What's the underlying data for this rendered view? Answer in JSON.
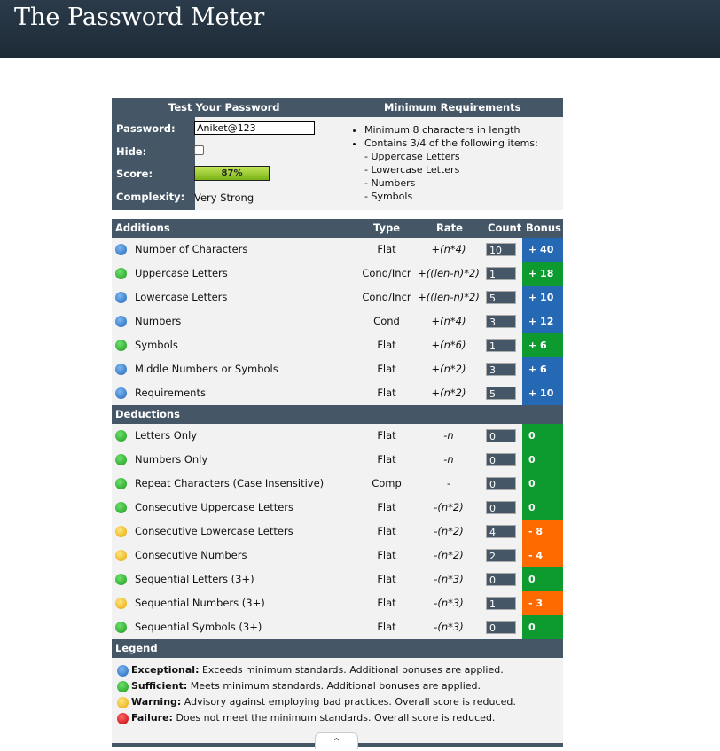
{
  "header": {
    "title": "The Password Meter"
  },
  "top": {
    "col1": "Test Your Password",
    "col2": "Minimum Requirements",
    "password_label": "Password:",
    "password_value": "Aniket@123",
    "hide_label": "Hide:",
    "score_label": "Score:",
    "score_value": "87%",
    "score_fraction": 0.87,
    "complexity_label": "Complexity:",
    "complexity_value": "Very Strong",
    "requirements": [
      "Minimum 8 characters in length",
      "Contains 3/4 of the following items:"
    ],
    "req_items": [
      "- Uppercase Letters",
      "- Lowercase Letters",
      "- Numbers",
      "- Symbols"
    ]
  },
  "additions": {
    "header": {
      "title": "Additions",
      "type": "Type",
      "rate": "Rate",
      "count": "Count",
      "bonus": "Bonus"
    },
    "rows": [
      {
        "icon": "exceptional-icon",
        "name": "Number of Characters",
        "type": "Flat",
        "rate": "+(n*4)",
        "count": "10",
        "bonus": "+ 40",
        "status": "exc"
      },
      {
        "icon": "sufficient-icon",
        "name": "Uppercase Letters",
        "type": "Cond/Incr",
        "rate": "+((len-n)*2)",
        "count": "1",
        "bonus": "+ 18",
        "status": "suf"
      },
      {
        "icon": "exceptional-icon",
        "name": "Lowercase Letters",
        "type": "Cond/Incr",
        "rate": "+((len-n)*2)",
        "count": "5",
        "bonus": "+ 10",
        "status": "exc"
      },
      {
        "icon": "exceptional-icon",
        "name": "Numbers",
        "type": "Cond",
        "rate": "+(n*4)",
        "count": "3",
        "bonus": "+ 12",
        "status": "exc"
      },
      {
        "icon": "sufficient-icon",
        "name": "Symbols",
        "type": "Flat",
        "rate": "+(n*6)",
        "count": "1",
        "bonus": "+ 6",
        "status": "suf"
      },
      {
        "icon": "exceptional-icon",
        "name": "Middle Numbers or Symbols",
        "type": "Flat",
        "rate": "+(n*2)",
        "count": "3",
        "bonus": "+ 6",
        "status": "exc"
      },
      {
        "icon": "exceptional-icon",
        "name": "Requirements",
        "type": "Flat",
        "rate": "+(n*2)",
        "count": "5",
        "bonus": "+ 10",
        "status": "exc"
      }
    ]
  },
  "deductions": {
    "title": "Deductions",
    "rows": [
      {
        "icon": "sufficient-icon",
        "name": "Letters Only",
        "type": "Flat",
        "rate": "-n",
        "count": "0",
        "bonus": "0",
        "status": "suf"
      },
      {
        "icon": "sufficient-icon",
        "name": "Numbers Only",
        "type": "Flat",
        "rate": "-n",
        "count": "0",
        "bonus": "0",
        "status": "suf"
      },
      {
        "icon": "sufficient-icon",
        "name": "Repeat Characters (Case Insensitive)",
        "type": "Comp",
        "rate": "-",
        "count": "0",
        "bonus": "0",
        "status": "suf"
      },
      {
        "icon": "sufficient-icon",
        "name": "Consecutive Uppercase Letters",
        "type": "Flat",
        "rate": "-(n*2)",
        "count": "0",
        "bonus": "0",
        "status": "suf"
      },
      {
        "icon": "warning-icon",
        "name": "Consecutive Lowercase Letters",
        "type": "Flat",
        "rate": "-(n*2)",
        "count": "4",
        "bonus": "- 8",
        "status": "war"
      },
      {
        "icon": "warning-icon",
        "name": "Consecutive Numbers",
        "type": "Flat",
        "rate": "-(n*2)",
        "count": "2",
        "bonus": "- 4",
        "status": "war"
      },
      {
        "icon": "sufficient-icon",
        "name": "Sequential Letters (3+)",
        "type": "Flat",
        "rate": "-(n*3)",
        "count": "0",
        "bonus": "0",
        "status": "suf"
      },
      {
        "icon": "warning-icon",
        "name": "Sequential Numbers (3+)",
        "type": "Flat",
        "rate": "-(n*3)",
        "count": "1",
        "bonus": "- 3",
        "status": "war"
      },
      {
        "icon": "sufficient-icon",
        "name": "Sequential Symbols (3+)",
        "type": "Flat",
        "rate": "-(n*3)",
        "count": "0",
        "bonus": "0",
        "status": "suf"
      }
    ]
  },
  "legend": {
    "title": "Legend",
    "items": [
      {
        "icon": "exceptional-icon",
        "status": "exc",
        "term": "Exceptional:",
        "desc": " Exceeds minimum standards. Additional bonuses are applied."
      },
      {
        "icon": "sufficient-icon",
        "status": "suf",
        "term": "Sufficient:",
        "desc": " Meets minimum standards. Additional bonuses are applied."
      },
      {
        "icon": "warning-icon",
        "status": "war",
        "term": "Warning:",
        "desc": " Advisory against employing bad practices. Overall score is reduced."
      },
      {
        "icon": "failure-icon",
        "status": "fail",
        "term": "Failure:",
        "desc": " Does not meet the minimum standards. Overall score is reduced."
      }
    ]
  },
  "colors": {
    "header_bg": "#1f2d3a",
    "bar_bg": "#455766",
    "exceptional": "#2568b4",
    "sufficient": "#0d9b2f",
    "warning": "#ff6a00"
  }
}
